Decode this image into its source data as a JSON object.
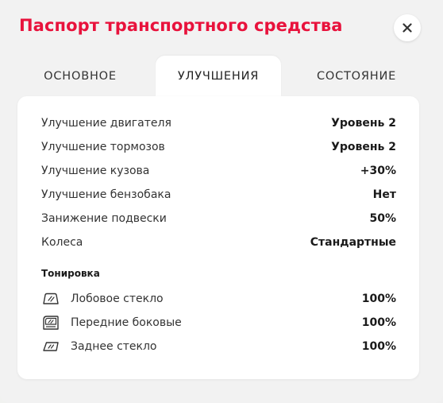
{
  "title": "Паспорт транспортного средства",
  "tabs": [
    {
      "label": "ОСНОВНОЕ"
    },
    {
      "label": "УЛУЧШЕНИЯ"
    },
    {
      "label": "СОСТОЯНИЕ"
    }
  ],
  "upgrades": [
    {
      "label": "Улучшение двигателя",
      "value": "Уровень 2"
    },
    {
      "label": "Улучшение тормозов",
      "value": "Уровень 2"
    },
    {
      "label": "Улучшение кузова",
      "value": "+30%"
    },
    {
      "label": "Улучшение бензобака",
      "value": "Нет"
    },
    {
      "label": "Занижение подвески",
      "value": "50%"
    },
    {
      "label": "Колеса",
      "value": "Стандартные"
    }
  ],
  "tint": {
    "heading": "Тонировка",
    "items": [
      {
        "label": "Лобовое стекло",
        "value": "100%",
        "icon": "windshield-icon"
      },
      {
        "label": "Передние боковые",
        "value": "100%",
        "icon": "side-window-icon"
      },
      {
        "label": "Заднее стекло",
        "value": "100%",
        "icon": "rear-window-icon"
      }
    ]
  },
  "colors": {
    "title": "#e8123c"
  }
}
